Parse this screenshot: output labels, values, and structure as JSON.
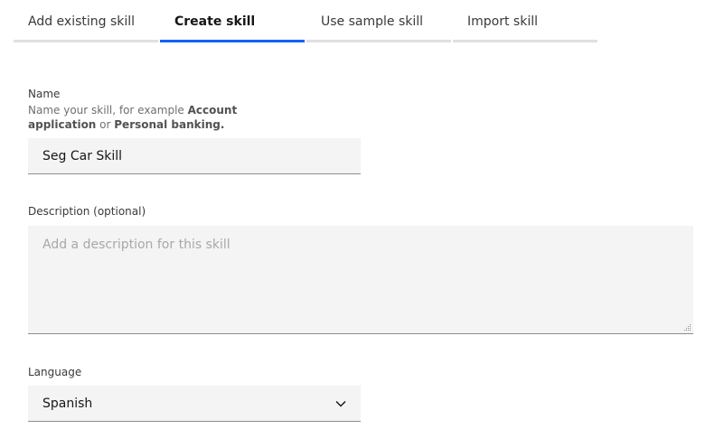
{
  "tabs": [
    {
      "label": "Add existing skill",
      "active": false
    },
    {
      "label": "Create skill",
      "active": true
    },
    {
      "label": "Use sample skill",
      "active": false
    },
    {
      "label": "Import skill",
      "active": false
    }
  ],
  "form": {
    "name": {
      "label": "Name",
      "helper_prefix": "Name your skill, for example ",
      "helper_example1": "Account application",
      "helper_or": " or ",
      "helper_example2": "Personal banking.",
      "value": "Seg Car Skill"
    },
    "description": {
      "label": "Description (optional)",
      "placeholder": "Add a description for this skill",
      "value": ""
    },
    "language": {
      "label": "Language",
      "selected": "Spanish"
    }
  },
  "colors": {
    "accent": "#0f62fe",
    "field_bg": "#f4f4f4",
    "tab_inactive_border": "#e0e0e0"
  },
  "icons": {
    "dropdown": "chevron-down-icon",
    "textarea_resize": "resize-grip-icon"
  }
}
